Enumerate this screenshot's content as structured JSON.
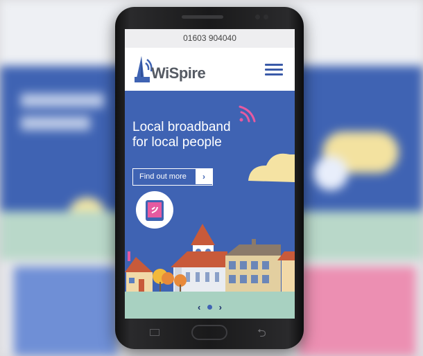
{
  "site": {
    "phone_number": "01603 904040",
    "logo_text": "WiSpire",
    "hero": {
      "headline_line1": "Local broadband",
      "headline_line2": "for local people",
      "cta_label": "Find out more",
      "cta_arrow": "›"
    },
    "pager": {
      "prev": "‹",
      "next": "›"
    }
  },
  "device": {
    "nav_buttons": [
      "recents",
      "home",
      "back"
    ],
    "back_glyph": "⮌"
  },
  "colors": {
    "brand_blue": "#3f63b3",
    "logo_grey": "#555a63",
    "signal_pink": "#e65aa0",
    "cloud_yellow": "#f5e3a3",
    "ground_green": "#a8d1c1"
  },
  "icons": [
    "wifi-signal-icon",
    "hamburger-menu-icon",
    "tablet-wifi-icon",
    "chevron-right-icon"
  ]
}
